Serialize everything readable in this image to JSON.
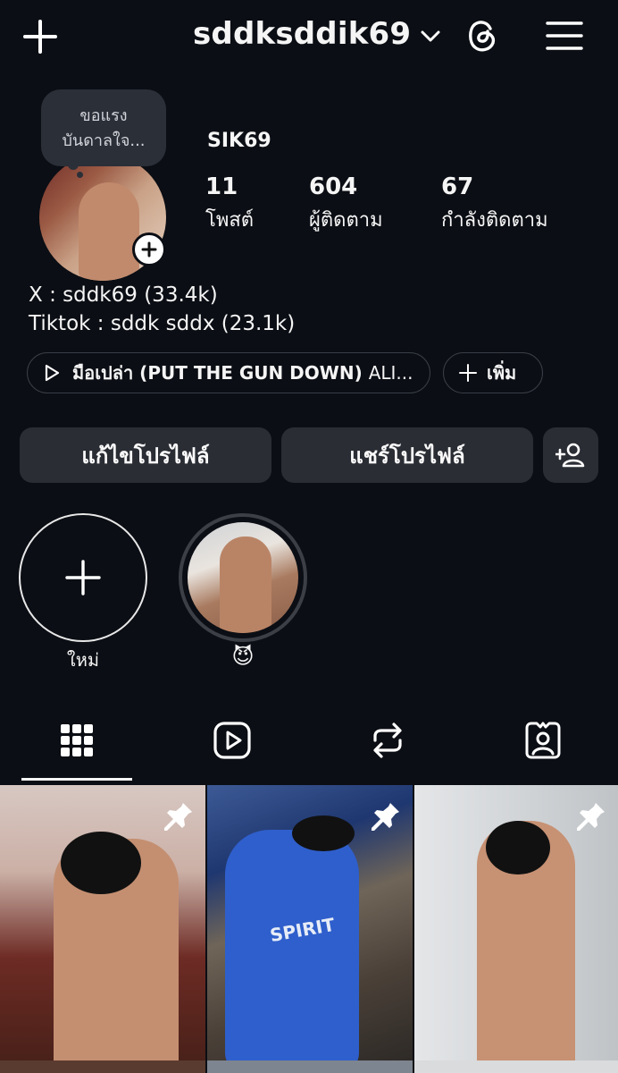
{
  "header": {
    "username": "sddksddik69"
  },
  "profile": {
    "note": "ขอแรง\nบันดาลใจ...",
    "display_name": "SIK69",
    "stats": [
      {
        "value": "11",
        "label": "โพสต์"
      },
      {
        "value": "604",
        "label": "ผู้ติดตาม"
      },
      {
        "value": "67",
        "label": "กำลังติดตาม"
      }
    ],
    "bio": [
      "X : sddk69 (33.4k)",
      "Tiktok : sddk sddx (23.1k)"
    ],
    "music": {
      "title": "มือเปล่า (PUT THE GUN DOWN)",
      "artist": "ALI..."
    },
    "more_label": "เพิ่ม"
  },
  "actions": {
    "edit_label": "แก้ไขโปรไฟล์",
    "share_label": "แชร์โปรไฟล์"
  },
  "highlights": [
    {
      "label": "ใหม่"
    },
    {
      "label": "😈"
    }
  ],
  "tabs": [
    "grid-icon",
    "reels-icon",
    "reposts-icon",
    "tagged-icon"
  ],
  "grid": {
    "posts": [
      {
        "pinned": true
      },
      {
        "pinned": true
      },
      {
        "pinned": true
      }
    ],
    "post2_shirt_text": "SPIRIT"
  },
  "colors": {
    "background": "#0b0e14",
    "button": "#2a2d34",
    "text": "#f5f5f5"
  }
}
